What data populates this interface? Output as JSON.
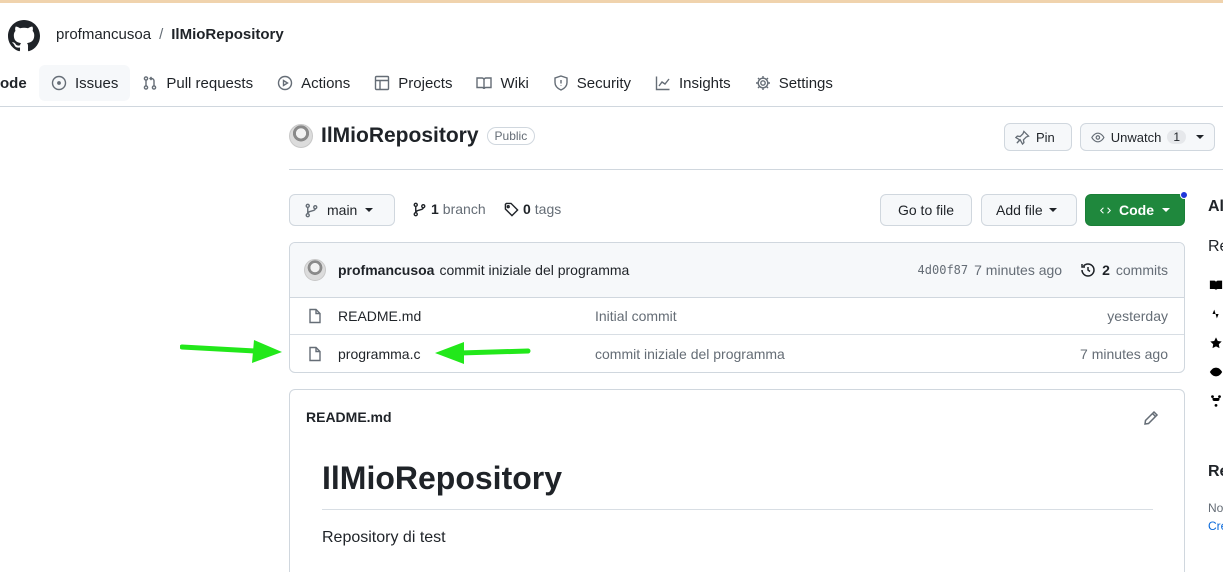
{
  "header": {
    "owner": "profmancusoa",
    "separator": "/",
    "repo": "IlMioRepository",
    "tabs": [
      {
        "label": "Code",
        "visible": "ode",
        "icon": "code-icon"
      },
      {
        "label": "Issues",
        "icon": "issue-opened-icon"
      },
      {
        "label": "Pull requests",
        "icon": "git-pull-request-icon"
      },
      {
        "label": "Actions",
        "icon": "play-icon"
      },
      {
        "label": "Projects",
        "icon": "table-icon"
      },
      {
        "label": "Wiki",
        "icon": "book-icon"
      },
      {
        "label": "Security",
        "icon": "shield-icon"
      },
      {
        "label": "Insights",
        "icon": "graph-icon"
      },
      {
        "label": "Settings",
        "icon": "gear-icon"
      }
    ]
  },
  "repo": {
    "name": "IlMioRepository",
    "visibility": "Public",
    "pin_label": "Pin",
    "watch_label": "Unwatch",
    "watch_count": "1"
  },
  "toolbar": {
    "branch": "main",
    "branch_count": "1",
    "branch_label": "branch",
    "tag_count": "0",
    "tag_label": "tags",
    "go_to_file": "Go to file",
    "add_file": "Add file",
    "code": "Code"
  },
  "latest_commit": {
    "author": "profmancusoa",
    "message": "commit iniziale del programma",
    "sha": "4d00f87",
    "age": "7 minutes ago",
    "commit_count": "2",
    "commit_label": "commits"
  },
  "files": [
    {
      "name": "README.md",
      "message": "Initial commit",
      "age": "yesterday"
    },
    {
      "name": "programma.c",
      "message": "commit iniziale del programma",
      "age": "7 minutes ago"
    }
  ],
  "readme": {
    "file": "README.md",
    "heading": "IlMioRepository",
    "body": "Repository di test"
  },
  "sidebar": {
    "about_heading": "Al",
    "description": "Re",
    "releases_heading": "Re",
    "no_releases": "No",
    "create_link": "Cre"
  },
  "colors": {
    "accent_green": "#1f883d",
    "annotation_arrow": "#22e81a",
    "tab_underline": "#fd8c73"
  }
}
